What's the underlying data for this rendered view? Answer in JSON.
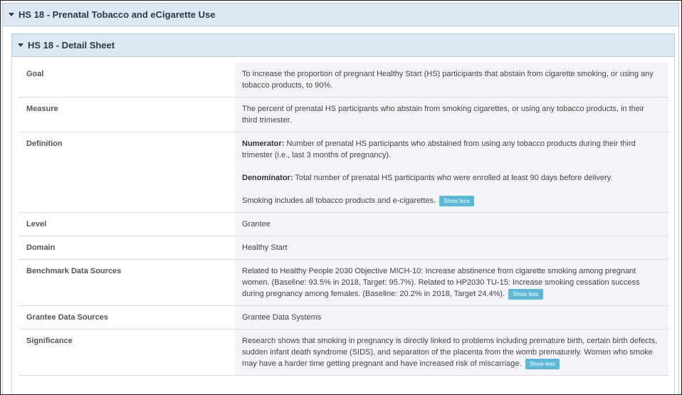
{
  "outer_header": {
    "title": "HS 18 - Prenatal Tobacco and eCigarette Use"
  },
  "inner_header": {
    "title": "HS 18 - Detail Sheet"
  },
  "rows": {
    "goal": {
      "label": "Goal",
      "value": "To increase the proportion of pregnant Healthy Start (HS) participants that abstain from cigarette smoking, or using any tobacco products, to 90%."
    },
    "measure": {
      "label": "Measure",
      "value": "The percent of prenatal HS participants who abstain from smoking cigarettes, or using any tobacco products, in their third trimester."
    },
    "definition": {
      "label": "Definition",
      "numerator_label": "Numerator:",
      "numerator_text": " Number of prenatal HS participants who abstained from using any tobacco products during their third trimester (i.e., last 3 months of pregnancy).",
      "denominator_label": "Denominator:",
      "denominator_text": " Total number of prenatal HS participants who were enrolled at least 90 days before delivery.",
      "note": "Smoking includes all tobacco products and e-cigarettes.",
      "button": "Show less"
    },
    "level": {
      "label": "Level",
      "value": "Grantee"
    },
    "domain": {
      "label": "Domain",
      "value": "Healthy Start"
    },
    "benchmark": {
      "label": "Benchmark Data Sources",
      "value": "Related to Healthy People 2030 Objective MICH-10: Increase abstinence from cigarette smoking among pregnant women. (Baseline: 93.5% in 2018, Target: 95.7%). Related to HP2030 TU-15: Increase smoking cessation success during pregnancy among females. (Baseline: 20.2% in 2018, Target 24.4%).",
      "button": "Show less"
    },
    "grantee_sources": {
      "label": "Grantee Data Sources",
      "value": "Grantee Data Systems"
    },
    "significance": {
      "label": "Significance",
      "value": "Research shows that smoking in pregnancy is directly linked to problems including premature birth, certain birth defects, sudden infant death syndrome (SIDS), and separation of the placenta from the womb prematurely. Women who smoke may have a harder time getting pregnant and have increased risk of miscarriage.",
      "button": "Show less"
    }
  }
}
